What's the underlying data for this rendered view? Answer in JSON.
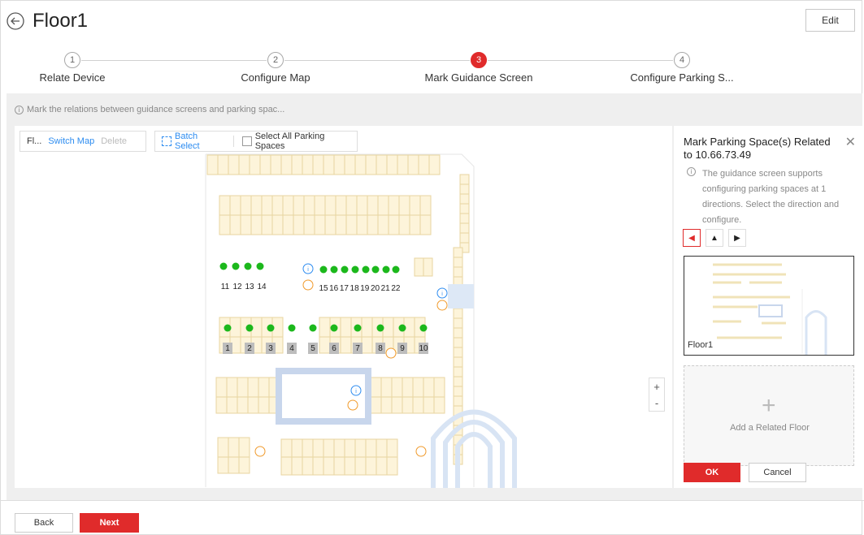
{
  "header": {
    "title": "Floor1",
    "edit_label": "Edit"
  },
  "steps": [
    {
      "number": "1",
      "label": "Relate Device"
    },
    {
      "number": "2",
      "label": "Configure Map"
    },
    {
      "number": "3",
      "label": "Mark Guidance Screen"
    },
    {
      "number": "4",
      "label": "Configure Parking S..."
    }
  ],
  "hint": "Mark the relations between guidance screens and parking spac...",
  "map_toolbar": {
    "floor": "Fl...",
    "switch_map": "Switch Map",
    "delete": "Delete",
    "batch_select": "Batch Select",
    "select_all": "Select All Parking Spaces"
  },
  "map": {
    "space_labels_row1": [
      "11",
      "12",
      "13",
      "14"
    ],
    "space_labels_row2": [
      "15",
      "16",
      "17",
      "18",
      "19",
      "20",
      "21",
      "22"
    ],
    "space_labels_row3": [
      "1",
      "2",
      "3",
      "4",
      "5",
      "6",
      "7",
      "8",
      "9",
      "10"
    ],
    "zoom_in": "+",
    "zoom_out": "-"
  },
  "panel": {
    "title": "Mark Parking Space(s) Related to 10.66.73.49",
    "note": "The guidance screen supports configuring parking spaces at 1 directions. Select the direction and configure.",
    "directions": [
      "<",
      "^",
      ">"
    ],
    "floor_thumb_label": "Floor1",
    "add_related_floor": "Add a Related Floor",
    "ok": "OK",
    "cancel": "Cancel"
  },
  "footer": {
    "back": "Back",
    "next": "Next"
  },
  "colors": {
    "accent": "#e02b2b",
    "link": "#2d8cf0",
    "occupied_dot": "#1cb81c"
  }
}
